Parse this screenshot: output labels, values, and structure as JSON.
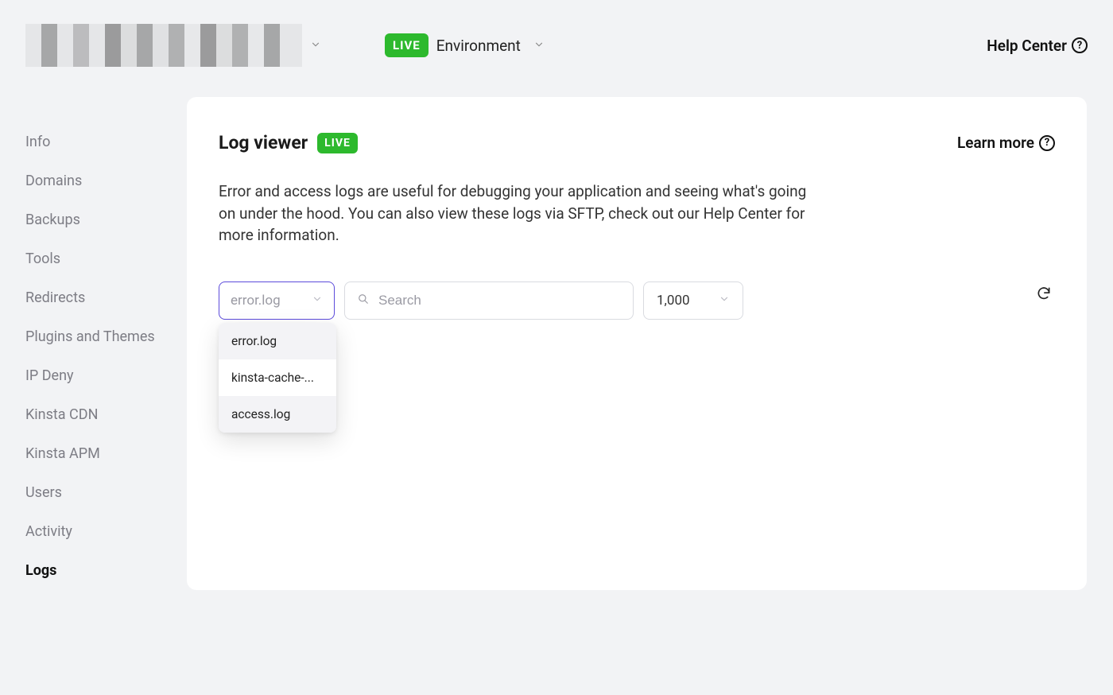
{
  "header": {
    "live_badge": "LIVE",
    "environment_label": "Environment",
    "help_center": "Help Center"
  },
  "sidebar": {
    "items": [
      {
        "label": "Info",
        "name": "sidebar-item-info"
      },
      {
        "label": "Domains",
        "name": "sidebar-item-domains"
      },
      {
        "label": "Backups",
        "name": "sidebar-item-backups"
      },
      {
        "label": "Tools",
        "name": "sidebar-item-tools"
      },
      {
        "label": "Redirects",
        "name": "sidebar-item-redirects"
      },
      {
        "label": "Plugins and Themes",
        "name": "sidebar-item-plugins-themes"
      },
      {
        "label": "IP Deny",
        "name": "sidebar-item-ip-deny"
      },
      {
        "label": "Kinsta CDN",
        "name": "sidebar-item-kinsta-cdn"
      },
      {
        "label": "Kinsta APM",
        "name": "sidebar-item-kinsta-apm"
      },
      {
        "label": "Users",
        "name": "sidebar-item-users"
      },
      {
        "label": "Activity",
        "name": "sidebar-item-activity"
      },
      {
        "label": "Logs",
        "name": "sidebar-item-logs"
      }
    ],
    "active_index": 11
  },
  "panel": {
    "title": "Log viewer",
    "badge": "LIVE",
    "learn_more": "Learn more",
    "description": "Error and access logs are useful for debugging your application and seeing what's going on under the hood. You can also view these logs via SFTP, check out our Help Center for more information."
  },
  "controls": {
    "log_select": {
      "value": "error.log",
      "options": [
        "error.log",
        "kinsta-cache-...",
        "access.log"
      ],
      "highlight_indices": [
        0,
        2
      ]
    },
    "search_placeholder": "Search",
    "count_value": "1,000"
  }
}
